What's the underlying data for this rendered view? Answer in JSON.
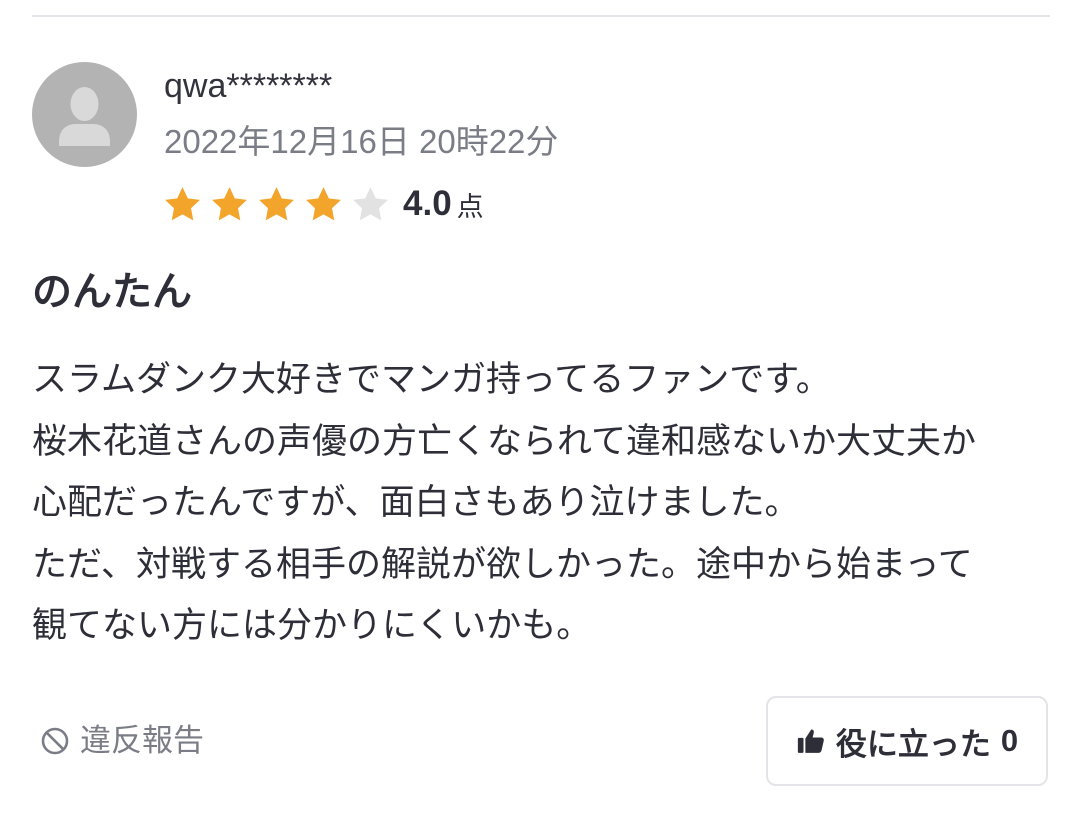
{
  "review": {
    "user": {
      "name": "qwa********"
    },
    "date": "2022年12月16日 20時22分",
    "rating": {
      "value": "4.0",
      "unit": "点",
      "stars_filled": 4,
      "stars_total": 5
    },
    "title": "のんたん",
    "body_lines": [
      "スラムダンク大好きでマンガ持ってるファンです。",
      "桜木花道さんの声優の方亡くなられて違和感ないか大丈夫か",
      "心配だったんですが、面白さもあり泣けました。",
      "ただ、対戦する相手の解説が欲しかった。途中から始まって",
      "観てない方には分かりにくいかも。"
    ]
  },
  "actions": {
    "report_label": "違反報告",
    "helpful_label": "役に立った",
    "helpful_count": "0"
  },
  "icons": {
    "avatar": "user-silhouette-icon",
    "star": "star-icon",
    "report": "prohibited-icon",
    "helpful": "thumbs-up-icon"
  },
  "colors": {
    "star_filled": "#f3a42b",
    "star_empty": "#e2e2e2",
    "avatar_bg": "#b3b3b3",
    "muted_text": "#7a7d86",
    "primary_text": "#2e2e38"
  }
}
